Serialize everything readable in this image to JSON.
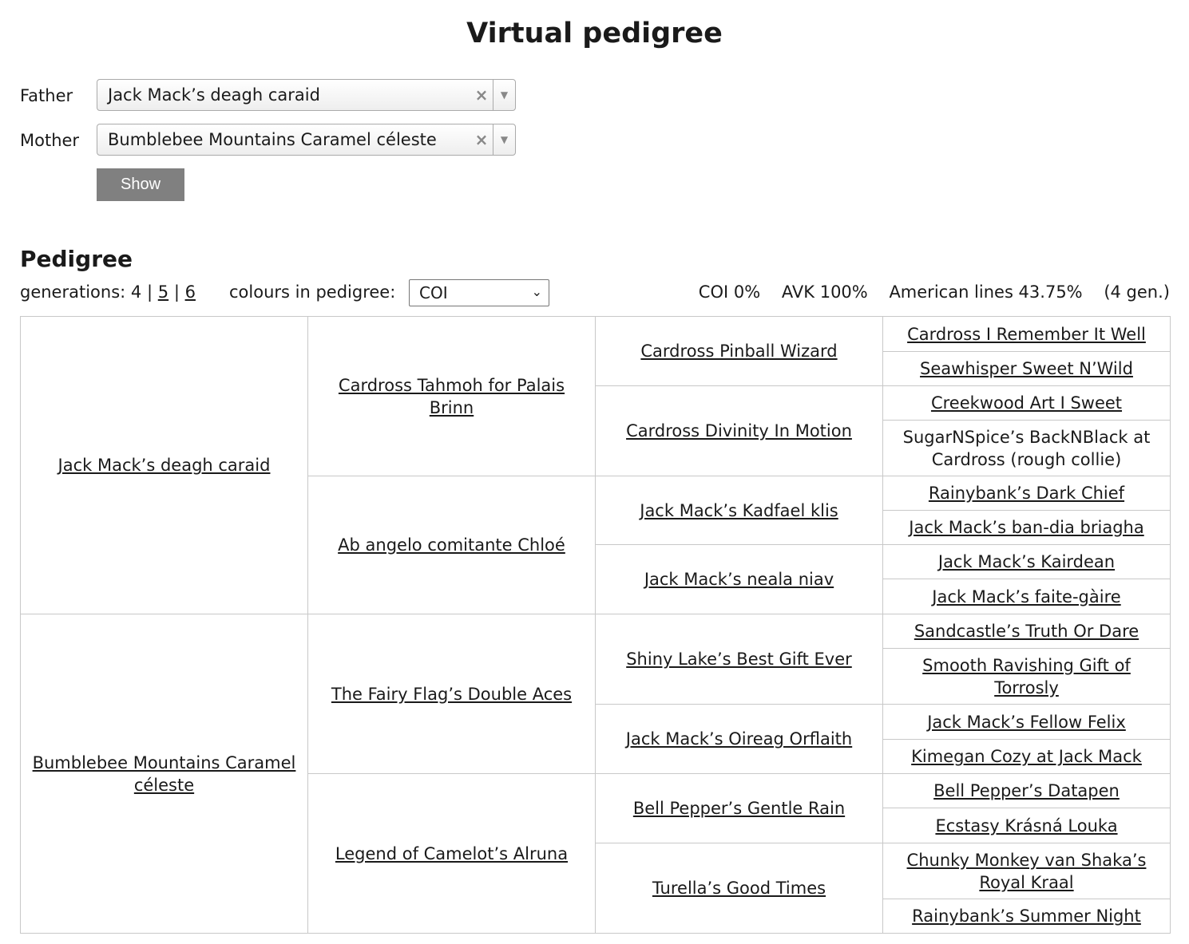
{
  "title": "Virtual pedigree",
  "form": {
    "father_label": "Father",
    "father_value": "Jack Mack’s deagh caraid",
    "mother_label": "Mother",
    "mother_value": "Bumblebee Mountains Caramel céleste",
    "clear_glyph": "×",
    "arrow_glyph": "▼",
    "show_label": "Show"
  },
  "pedigree": {
    "heading": "Pedigree",
    "generations_label": "generations:",
    "gen_current": "4",
    "gen_sep1": "|",
    "gen_link5": "5",
    "gen_sep2": "|",
    "gen_link6": "6",
    "colours_label": "colours in pedigree:",
    "colours_value": "COI",
    "colours_chevron": "⌄",
    "stats": {
      "coi": "COI 0%",
      "avk": "AVK 100%",
      "american": "American lines 43.75%",
      "gens": "(4 gen.)"
    },
    "parents": [
      "Jack Mack’s deagh caraid",
      "Bumblebee Mountains Caramel céleste"
    ],
    "grandparents": [
      "Cardross Tahmoh for Palais Brinn",
      "Ab angelo comitante Chloé",
      "The Fairy Flag’s Double Aces",
      "Legend of Camelot’s Alruna"
    ],
    "great_grandparents": [
      "Cardross Pinball Wizard",
      "Cardross Divinity In Motion",
      "Jack Mack’s Kadfael klis",
      "Jack Mack’s neala niav",
      "Shiny Lake’s Best Gift Ever",
      "Jack Mack’s Oireag Orflaith",
      "Bell Pepper’s Gentle Rain",
      "Turella’s Good Times"
    ],
    "great_great_grandparents": [
      {
        "name": "Cardross I Remember It Well",
        "linked": true
      },
      {
        "name": "Seawhisper Sweet N’Wild",
        "linked": true
      },
      {
        "name": "Creekwood Art I Sweet",
        "linked": true
      },
      {
        "name": "SugarNSpice’s BackNBlack at Cardross (rough collie)",
        "linked": false
      },
      {
        "name": "Rainybank’s Dark Chief",
        "linked": true
      },
      {
        "name": "Jack Mack’s ban-dia briagha",
        "linked": true
      },
      {
        "name": "Jack Mack’s Kairdean",
        "linked": true
      },
      {
        "name": "Jack Mack’s faite-gàire",
        "linked": true
      },
      {
        "name": "Sandcastle’s Truth Or Dare",
        "linked": true
      },
      {
        "name": "Smooth Ravishing Gift of Torrosly",
        "linked": true
      },
      {
        "name": "Jack Mack’s Fellow Felix",
        "linked": true
      },
      {
        "name": "Kimegan Cozy at Jack Mack",
        "linked": true
      },
      {
        "name": "Bell Pepper’s Datapen",
        "linked": true
      },
      {
        "name": "Ecstasy Krásná Louka",
        "linked": true
      },
      {
        "name": "Chunky Monkey van Shaka’s Royal Kraal",
        "linked": true
      },
      {
        "name": "Rainybank’s Summer Night",
        "linked": true
      }
    ]
  }
}
